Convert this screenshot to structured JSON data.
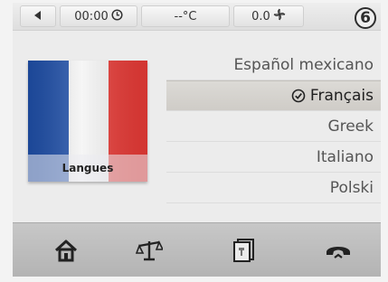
{
  "status_bar": {
    "time": "00:00",
    "temperature": "--°C",
    "fan": "0.0",
    "step_number": "6"
  },
  "flag_card": {
    "label": "Langues"
  },
  "languages": {
    "items": [
      {
        "label": "Español mexicano",
        "selected": false
      },
      {
        "label": "Français",
        "selected": true
      },
      {
        "label": "Greek",
        "selected": false
      },
      {
        "label": "Italiano",
        "selected": false
      },
      {
        "label": "Polski",
        "selected": false
      }
    ]
  },
  "bottom_nav": {
    "icons": [
      "home-icon",
      "scale-icon",
      "book-icon",
      "phone-icon"
    ]
  },
  "colors": {
    "flag_blue": "#1f4fa8",
    "flag_white": "#f4f4f4",
    "flag_red": "#e53935",
    "selected_row": "#d3d0cb",
    "bottom_bar": "#bdbdbd"
  }
}
